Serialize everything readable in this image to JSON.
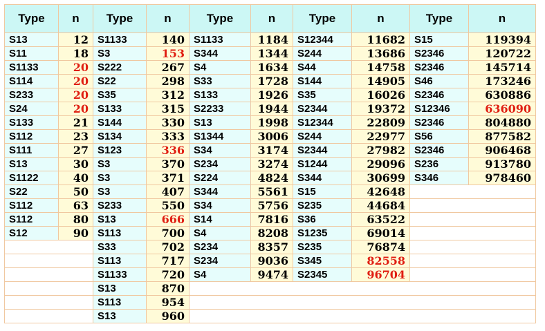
{
  "colors": {
    "header_bg": "#ccf7f5",
    "type_bg": "#e6fdfc",
    "n_bg": "#fffbd8",
    "border": "#f0c8a0",
    "highlight": "#e01e12"
  },
  "column_groups": [
    {
      "type_header": "Type",
      "n_header": "n",
      "rows": [
        {
          "type": "S13",
          "n": "12",
          "highlight": false
        },
        {
          "type": "S11",
          "n": "18",
          "highlight": false
        },
        {
          "type": "S1133",
          "n": "20",
          "highlight": true
        },
        {
          "type": "S114",
          "n": "20",
          "highlight": true
        },
        {
          "type": "S233",
          "n": "20",
          "highlight": true
        },
        {
          "type": "S24",
          "n": "20",
          "highlight": true
        },
        {
          "type": "S133",
          "n": "21",
          "highlight": false
        },
        {
          "type": "S112",
          "n": "23",
          "highlight": false
        },
        {
          "type": "S111",
          "n": "27",
          "highlight": false
        },
        {
          "type": "S13",
          "n": "30",
          "highlight": false
        },
        {
          "type": "S1122",
          "n": "40",
          "highlight": false
        },
        {
          "type": "S22",
          "n": "50",
          "highlight": false
        },
        {
          "type": "S112",
          "n": "63",
          "highlight": false
        },
        {
          "type": "S112",
          "n": "80",
          "highlight": false
        },
        {
          "type": "S12",
          "n": "90",
          "highlight": false
        }
      ]
    },
    {
      "type_header": "Type",
      "n_header": "n",
      "rows": [
        {
          "type": "S1133",
          "n": "140",
          "highlight": false
        },
        {
          "type": "S3",
          "n": "153",
          "highlight": true
        },
        {
          "type": "S222",
          "n": "267",
          "highlight": false
        },
        {
          "type": "S22",
          "n": "298",
          "highlight": false
        },
        {
          "type": "S35",
          "n": "312",
          "highlight": false
        },
        {
          "type": "S133",
          "n": "315",
          "highlight": false
        },
        {
          "type": "S144",
          "n": "330",
          "highlight": false
        },
        {
          "type": "S134",
          "n": "333",
          "highlight": false
        },
        {
          "type": "S123",
          "n": "336",
          "highlight": true
        },
        {
          "type": "S3",
          "n": "370",
          "highlight": false
        },
        {
          "type": "S3",
          "n": "371",
          "highlight": false
        },
        {
          "type": "S3",
          "n": "407",
          "highlight": false
        },
        {
          "type": "S233",
          "n": "550",
          "highlight": false
        },
        {
          "type": "S13",
          "n": "666",
          "highlight": true
        },
        {
          "type": "S113",
          "n": "700",
          "highlight": false
        },
        {
          "type": "S33",
          "n": "702",
          "highlight": false
        },
        {
          "type": "S113",
          "n": "717",
          "highlight": false
        },
        {
          "type": "S1133",
          "n": "720",
          "highlight": false
        },
        {
          "type": "S13",
          "n": "870",
          "highlight": false
        },
        {
          "type": "S113",
          "n": "954",
          "highlight": false
        },
        {
          "type": "S13",
          "n": "960",
          "highlight": false
        }
      ]
    },
    {
      "type_header": "Type",
      "n_header": "n",
      "rows": [
        {
          "type": "S1133",
          "n": "1184",
          "highlight": false
        },
        {
          "type": "S344",
          "n": "1344",
          "highlight": false
        },
        {
          "type": "S4",
          "n": "1634",
          "highlight": false
        },
        {
          "type": "S33",
          "n": "1728",
          "highlight": false
        },
        {
          "type": "S133",
          "n": "1926",
          "highlight": false
        },
        {
          "type": "S2233",
          "n": "1944",
          "highlight": false
        },
        {
          "type": "S13",
          "n": "1998",
          "highlight": false
        },
        {
          "type": "S1344",
          "n": "3006",
          "highlight": false
        },
        {
          "type": "S34",
          "n": "3174",
          "highlight": false
        },
        {
          "type": "S234",
          "n": "3274",
          "highlight": false
        },
        {
          "type": "S224",
          "n": "4824",
          "highlight": false
        },
        {
          "type": "S344",
          "n": "5561",
          "highlight": false
        },
        {
          "type": "S34",
          "n": "5756",
          "highlight": false
        },
        {
          "type": "S14",
          "n": "7816",
          "highlight": false
        },
        {
          "type": "S4",
          "n": "8208",
          "highlight": false
        },
        {
          "type": "S234",
          "n": "8357",
          "highlight": false
        },
        {
          "type": "S234",
          "n": "9036",
          "highlight": false
        },
        {
          "type": "S4",
          "n": "9474",
          "highlight": false
        }
      ]
    },
    {
      "type_header": "Type",
      "n_header": "n",
      "rows": [
        {
          "type": "S12344",
          "n": "11682",
          "highlight": false
        },
        {
          "type": "S244",
          "n": "13686",
          "highlight": false
        },
        {
          "type": "S44",
          "n": "14758",
          "highlight": false
        },
        {
          "type": "S144",
          "n": "14905",
          "highlight": false
        },
        {
          "type": "S35",
          "n": "16026",
          "highlight": false
        },
        {
          "type": "S2344",
          "n": "19372",
          "highlight": false
        },
        {
          "type": "S12344",
          "n": "22809",
          "highlight": false
        },
        {
          "type": "S244",
          "n": "22977",
          "highlight": false
        },
        {
          "type": "S2344",
          "n": "27982",
          "highlight": false
        },
        {
          "type": "S1244",
          "n": "29096",
          "highlight": false
        },
        {
          "type": "S344",
          "n": "30699",
          "highlight": false
        },
        {
          "type": "S15",
          "n": "42648",
          "highlight": false
        },
        {
          "type": "S235",
          "n": "44684",
          "highlight": false
        },
        {
          "type": "S36",
          "n": "63522",
          "highlight": false
        },
        {
          "type": "S1235",
          "n": "69014",
          "highlight": false
        },
        {
          "type": "S235",
          "n": "76874",
          "highlight": false
        },
        {
          "type": "S345",
          "n": "82558",
          "highlight": true
        },
        {
          "type": "S2345",
          "n": "96704",
          "highlight": true
        }
      ]
    },
    {
      "type_header": "Type",
      "n_header": "n",
      "rows": [
        {
          "type": "S15",
          "n": "119394",
          "highlight": false
        },
        {
          "type": "S2346",
          "n": "120722",
          "highlight": false
        },
        {
          "type": "S2346",
          "n": "145714",
          "highlight": false
        },
        {
          "type": "S46",
          "n": "173246",
          "highlight": false
        },
        {
          "type": "S2346",
          "n": "630886",
          "highlight": false
        },
        {
          "type": "S12346",
          "n": "636090",
          "highlight": true
        },
        {
          "type": "S2346",
          "n": "804880",
          "highlight": false
        },
        {
          "type": "S56",
          "n": "877582",
          "highlight": false
        },
        {
          "type": "S2346",
          "n": "906468",
          "highlight": false
        },
        {
          "type": "S236",
          "n": "913780",
          "highlight": false
        },
        {
          "type": "S346",
          "n": "978460",
          "highlight": false
        }
      ]
    }
  ]
}
